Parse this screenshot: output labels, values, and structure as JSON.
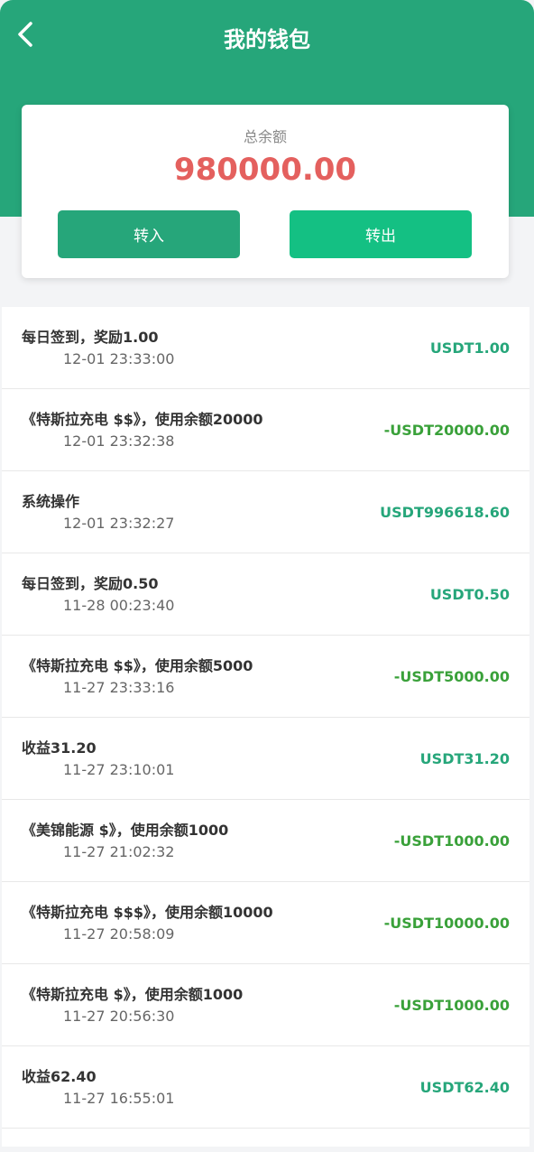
{
  "header": {
    "title": "我的钱包"
  },
  "balance": {
    "label": "总余额",
    "amount": "980000.00",
    "transfer_in_label": "转入",
    "transfer_out_label": "转出"
  },
  "transactions": [
    {
      "title": "每日签到，奖励1.00",
      "time": "12-01 23:33:00",
      "amount": "USDT1.00",
      "sign": "pos"
    },
    {
      "title": "《特斯拉充电 $$》，使用余额20000",
      "time": "12-01 23:32:38",
      "amount": "-USDT20000.00",
      "sign": "neg"
    },
    {
      "title": "系统操作",
      "time": "12-01 23:32:27",
      "amount": "USDT996618.60",
      "sign": "pos"
    },
    {
      "title": "每日签到，奖励0.50",
      "time": "11-28 00:23:40",
      "amount": "USDT0.50",
      "sign": "pos"
    },
    {
      "title": "《特斯拉充电 $$》，使用余额5000",
      "time": "11-27 23:33:16",
      "amount": "-USDT5000.00",
      "sign": "neg"
    },
    {
      "title": "收益31.20",
      "time": "11-27 23:10:01",
      "amount": "USDT31.20",
      "sign": "pos"
    },
    {
      "title": "《美锦能源 $》，使用余额1000",
      "time": "11-27 21:02:32",
      "amount": "-USDT1000.00",
      "sign": "neg"
    },
    {
      "title": "《特斯拉充电 $$$》，使用余额10000",
      "time": "11-27 20:58:09",
      "amount": "-USDT10000.00",
      "sign": "neg"
    },
    {
      "title": "《特斯拉充电 $》，使用余额1000",
      "time": "11-27 20:56:30",
      "amount": "-USDT1000.00",
      "sign": "neg"
    },
    {
      "title": "收益62.40",
      "time": "11-27 16:55:01",
      "amount": "USDT62.40",
      "sign": "pos"
    }
  ],
  "colors": {
    "brand": "#26a67a",
    "amount_highlight": "#e4605e",
    "negative": "#3aa13a"
  }
}
